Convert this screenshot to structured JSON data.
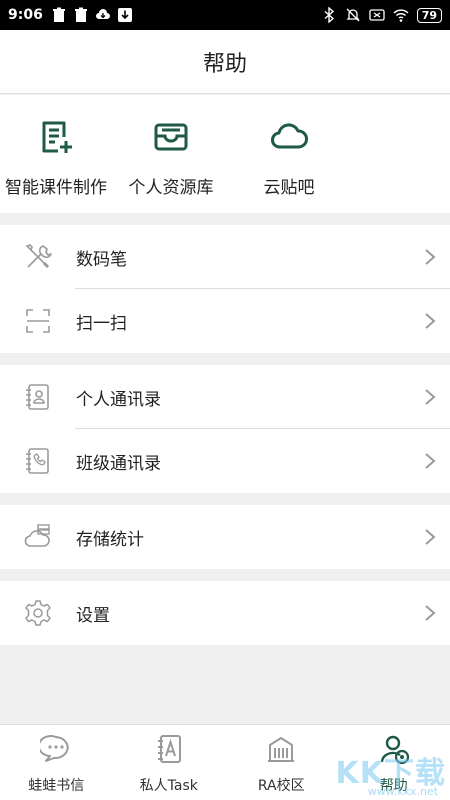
{
  "status_bar": {
    "time": "9:06",
    "battery": "79"
  },
  "header": {
    "title": "帮助"
  },
  "shortcuts": [
    {
      "label": "智能课件制作",
      "icon": "document-plus-icon"
    },
    {
      "label": "个人资源库",
      "icon": "inbox-tray-icon"
    },
    {
      "label": "云贴吧",
      "icon": "cloud-icon"
    }
  ],
  "menu": {
    "digital_pen": "数码笔",
    "scan": "扫一扫",
    "personal_contacts": "个人通讯录",
    "class_contacts": "班级通讯录",
    "storage_stats": "存储统计",
    "settings": "设置"
  },
  "tabs": [
    {
      "label": "蛙蛙书信",
      "icon": "chat-bubble-icon"
    },
    {
      "label": "私人Task",
      "icon": "notebook-a-icon"
    },
    {
      "label": "RA校区",
      "icon": "campus-building-icon"
    },
    {
      "label": "帮助",
      "icon": "user-help-icon",
      "active": true
    }
  ],
  "watermark": {
    "main": "KK下载",
    "sub": "www.kkx.net"
  },
  "colors": {
    "accent": "#1f5a44",
    "gray_icon": "#9a9a9a",
    "separator": "#f0f0f0"
  }
}
